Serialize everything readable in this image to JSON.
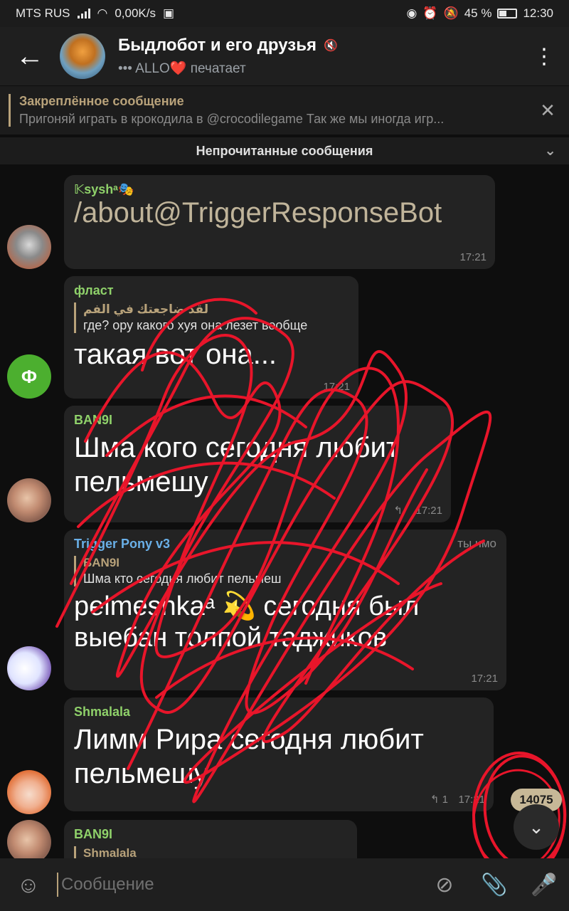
{
  "status_bar": {
    "carrier": "MTS RUS",
    "speed": "0,00K/s",
    "battery": "45 %",
    "time": "12:30"
  },
  "header": {
    "title": "Быдлобот и его друзья",
    "status": "••• ALLO❤️ печатает"
  },
  "pinned": {
    "title": "Закреплённое сообщение",
    "text": "Пригоняй играть в крокодила в @crocodilegame Так же мы иногда игр..."
  },
  "unread_label": "Непрочитанные сообщения",
  "messages": [
    {
      "sender": "𝕂syshᵃ🎭",
      "text": "/about@TriggerResponseBot",
      "time": "17:21",
      "sender_color": "#8fd16a"
    },
    {
      "sender": "фласт",
      "reply_name": "لقد ضاجعتك في الفم",
      "reply_text": "где? ору какого хуя она лезет вообще",
      "text": "такая вот она...",
      "time": "17:21",
      "avatar_letter": "Ф",
      "sender_color": "#8fd16a"
    },
    {
      "sender": "BAN9I",
      "text": "Шма кого сегодня любит пельмешу",
      "time": "17:21",
      "sender_color": "#8fd16a"
    },
    {
      "sender": "Trigger Pony v3",
      "role": "ты чмо",
      "reply_name": "BAN9I",
      "reply_text": "Шма кто сегодня любит пельмеш",
      "text": "pelmesnkaᵃ 💫 сегодня был выебан толпой таджиков",
      "time": "17:21",
      "sender_color": "#6ab0e8"
    },
    {
      "sender": "Shmalala",
      "text": "Лимм Рира сегодня любит пельмешу",
      "replies": "↰ 1",
      "time": "17:21",
      "sender_color": "#8fd16a"
    },
    {
      "sender": "BAN9I",
      "reply_name": "Shmalala",
      "sender_color": "#8fd16a"
    }
  ],
  "unread_count": "14075",
  "input": {
    "placeholder": "Сообщение"
  },
  "colors": {
    "accent": "#b8a27a",
    "scribble": "#e8152a"
  }
}
